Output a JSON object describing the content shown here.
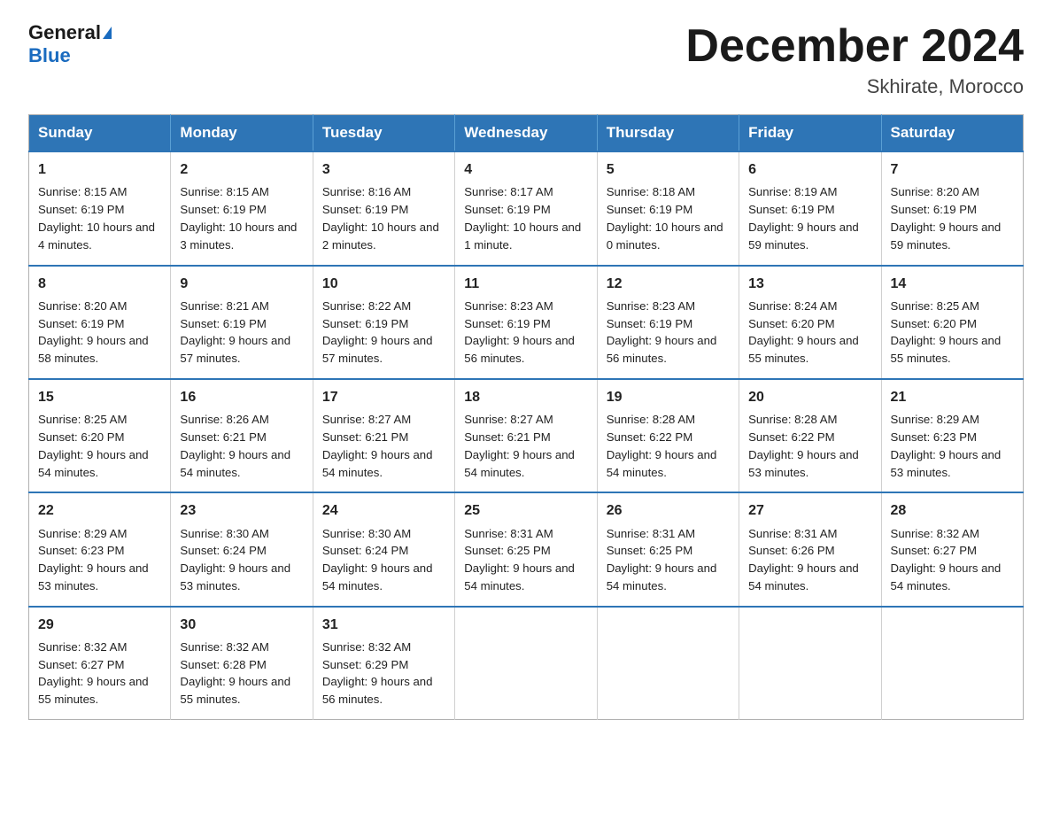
{
  "logo": {
    "general": "General",
    "blue": "Blue"
  },
  "title": "December 2024",
  "location": "Skhirate, Morocco",
  "days_of_week": [
    "Sunday",
    "Monday",
    "Tuesday",
    "Wednesday",
    "Thursday",
    "Friday",
    "Saturday"
  ],
  "weeks": [
    [
      {
        "day": "1",
        "sunrise": "8:15 AM",
        "sunset": "6:19 PM",
        "daylight": "10 hours and 4 minutes."
      },
      {
        "day": "2",
        "sunrise": "8:15 AM",
        "sunset": "6:19 PM",
        "daylight": "10 hours and 3 minutes."
      },
      {
        "day": "3",
        "sunrise": "8:16 AM",
        "sunset": "6:19 PM",
        "daylight": "10 hours and 2 minutes."
      },
      {
        "day": "4",
        "sunrise": "8:17 AM",
        "sunset": "6:19 PM",
        "daylight": "10 hours and 1 minute."
      },
      {
        "day": "5",
        "sunrise": "8:18 AM",
        "sunset": "6:19 PM",
        "daylight": "10 hours and 0 minutes."
      },
      {
        "day": "6",
        "sunrise": "8:19 AM",
        "sunset": "6:19 PM",
        "daylight": "9 hours and 59 minutes."
      },
      {
        "day": "7",
        "sunrise": "8:20 AM",
        "sunset": "6:19 PM",
        "daylight": "9 hours and 59 minutes."
      }
    ],
    [
      {
        "day": "8",
        "sunrise": "8:20 AM",
        "sunset": "6:19 PM",
        "daylight": "9 hours and 58 minutes."
      },
      {
        "day": "9",
        "sunrise": "8:21 AM",
        "sunset": "6:19 PM",
        "daylight": "9 hours and 57 minutes."
      },
      {
        "day": "10",
        "sunrise": "8:22 AM",
        "sunset": "6:19 PM",
        "daylight": "9 hours and 57 minutes."
      },
      {
        "day": "11",
        "sunrise": "8:23 AM",
        "sunset": "6:19 PM",
        "daylight": "9 hours and 56 minutes."
      },
      {
        "day": "12",
        "sunrise": "8:23 AM",
        "sunset": "6:19 PM",
        "daylight": "9 hours and 56 minutes."
      },
      {
        "day": "13",
        "sunrise": "8:24 AM",
        "sunset": "6:20 PM",
        "daylight": "9 hours and 55 minutes."
      },
      {
        "day": "14",
        "sunrise": "8:25 AM",
        "sunset": "6:20 PM",
        "daylight": "9 hours and 55 minutes."
      }
    ],
    [
      {
        "day": "15",
        "sunrise": "8:25 AM",
        "sunset": "6:20 PM",
        "daylight": "9 hours and 54 minutes."
      },
      {
        "day": "16",
        "sunrise": "8:26 AM",
        "sunset": "6:21 PM",
        "daylight": "9 hours and 54 minutes."
      },
      {
        "day": "17",
        "sunrise": "8:27 AM",
        "sunset": "6:21 PM",
        "daylight": "9 hours and 54 minutes."
      },
      {
        "day": "18",
        "sunrise": "8:27 AM",
        "sunset": "6:21 PM",
        "daylight": "9 hours and 54 minutes."
      },
      {
        "day": "19",
        "sunrise": "8:28 AM",
        "sunset": "6:22 PM",
        "daylight": "9 hours and 54 minutes."
      },
      {
        "day": "20",
        "sunrise": "8:28 AM",
        "sunset": "6:22 PM",
        "daylight": "9 hours and 53 minutes."
      },
      {
        "day": "21",
        "sunrise": "8:29 AM",
        "sunset": "6:23 PM",
        "daylight": "9 hours and 53 minutes."
      }
    ],
    [
      {
        "day": "22",
        "sunrise": "8:29 AM",
        "sunset": "6:23 PM",
        "daylight": "9 hours and 53 minutes."
      },
      {
        "day": "23",
        "sunrise": "8:30 AM",
        "sunset": "6:24 PM",
        "daylight": "9 hours and 53 minutes."
      },
      {
        "day": "24",
        "sunrise": "8:30 AM",
        "sunset": "6:24 PM",
        "daylight": "9 hours and 54 minutes."
      },
      {
        "day": "25",
        "sunrise": "8:31 AM",
        "sunset": "6:25 PM",
        "daylight": "9 hours and 54 minutes."
      },
      {
        "day": "26",
        "sunrise": "8:31 AM",
        "sunset": "6:25 PM",
        "daylight": "9 hours and 54 minutes."
      },
      {
        "day": "27",
        "sunrise": "8:31 AM",
        "sunset": "6:26 PM",
        "daylight": "9 hours and 54 minutes."
      },
      {
        "day": "28",
        "sunrise": "8:32 AM",
        "sunset": "6:27 PM",
        "daylight": "9 hours and 54 minutes."
      }
    ],
    [
      {
        "day": "29",
        "sunrise": "8:32 AM",
        "sunset": "6:27 PM",
        "daylight": "9 hours and 55 minutes."
      },
      {
        "day": "30",
        "sunrise": "8:32 AM",
        "sunset": "6:28 PM",
        "daylight": "9 hours and 55 minutes."
      },
      {
        "day": "31",
        "sunrise": "8:32 AM",
        "sunset": "6:29 PM",
        "daylight": "9 hours and 56 minutes."
      },
      null,
      null,
      null,
      null
    ]
  ]
}
